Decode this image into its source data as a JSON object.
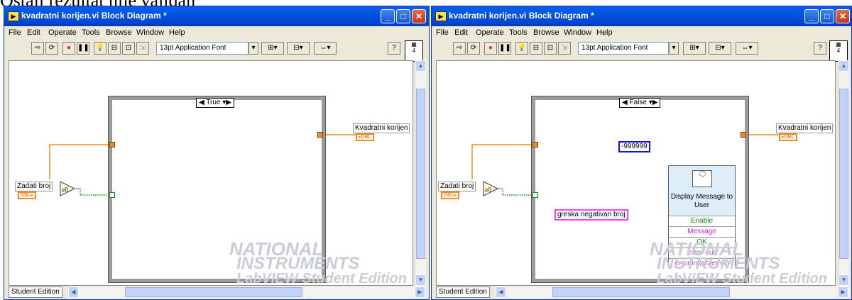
{
  "top_text": "Ostali rezultat nije validan",
  "windows": [
    {
      "title": "kvadratni korijen.vi Block Diagram *",
      "menu": [
        "File",
        "Edit",
        "Operate",
        "Tools",
        "Browse",
        "Window",
        "Help"
      ],
      "font_select": "13pt Application Font",
      "case_selector": "True",
      "control_label": "Zadati broj",
      "indicator_label": "Kvadratni korijen",
      "type_tag": "DBL",
      "status": "Student Edition",
      "watermark_brand1": "NATIONAL",
      "watermark_brand2": "INSTRUMENTS",
      "watermark_edition": "LabVIEW Student Edition"
    },
    {
      "title": "kvadratni korijen.vi Block Diagram *",
      "menu": [
        "File",
        "Edit",
        "Operate",
        "Tools",
        "Browse",
        "Window",
        "Help"
      ],
      "font_select": "13pt Application Font",
      "case_selector": "False",
      "control_label": "Zadati broj",
      "indicator_label": "Kvadratni korijen",
      "type_tag": "DBL",
      "constant": "-999999",
      "string_constant": "greska negativan broj",
      "message_node": {
        "title": "Display Message to User",
        "pins": [
          "Enable",
          "Message",
          "OK",
          "error out",
          "error in (no error)"
        ]
      },
      "status": "Student Edition",
      "watermark_brand1": "NATIONAL",
      "watermark_brand2": "INSTRUMENTS",
      "watermark_edition": "LabVIEW Student Edition"
    }
  ],
  "colors": {
    "titlebar": "#0054e3",
    "dbl_wire": "#f08c20",
    "bool_wire": "#1a8a1a",
    "int_const": "#1414e0",
    "string_wire": "#ff40ff"
  }
}
